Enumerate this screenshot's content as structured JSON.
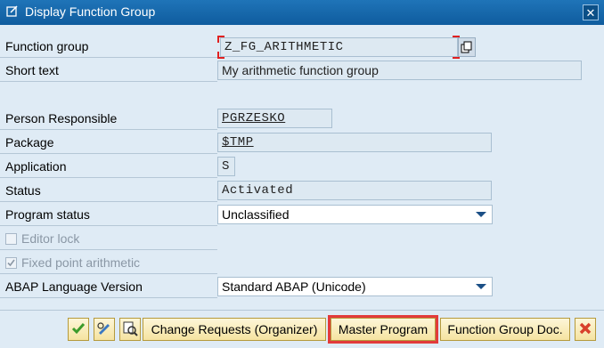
{
  "window": {
    "title": "Display Function Group",
    "title_icon": "display-doc-icon",
    "close_icon": "close-icon"
  },
  "form": {
    "function_group": {
      "label": "Function group",
      "value": "Z_FG_ARITHMETIC"
    },
    "short_text": {
      "label": "Short text",
      "value": "My arithmetic function group"
    },
    "person_responsible": {
      "label": "Person Responsible",
      "value": "PGRZESKO"
    },
    "package": {
      "label": "Package",
      "value": "$TMP"
    },
    "application": {
      "label": "Application",
      "value": "S"
    },
    "status": {
      "label": "Status",
      "value": "Activated"
    },
    "program_status": {
      "label": "Program status",
      "value": "Unclassified"
    },
    "editor_lock": {
      "label": "Editor lock",
      "checked": false
    },
    "fixed_point": {
      "label": "Fixed point arithmetic",
      "checked": true
    },
    "abap_version": {
      "label": "ABAP Language Version",
      "value": "Standard ABAP (Unicode)"
    }
  },
  "footer": {
    "change_requests": "Change Requests (Organizer)",
    "master_program": "Master Program",
    "function_group_doc": "Function Group Doc."
  },
  "colors": {
    "accent_title": "#1565a8",
    "highlight": "#e23b3b",
    "button_bg": "#f5e3a0"
  }
}
